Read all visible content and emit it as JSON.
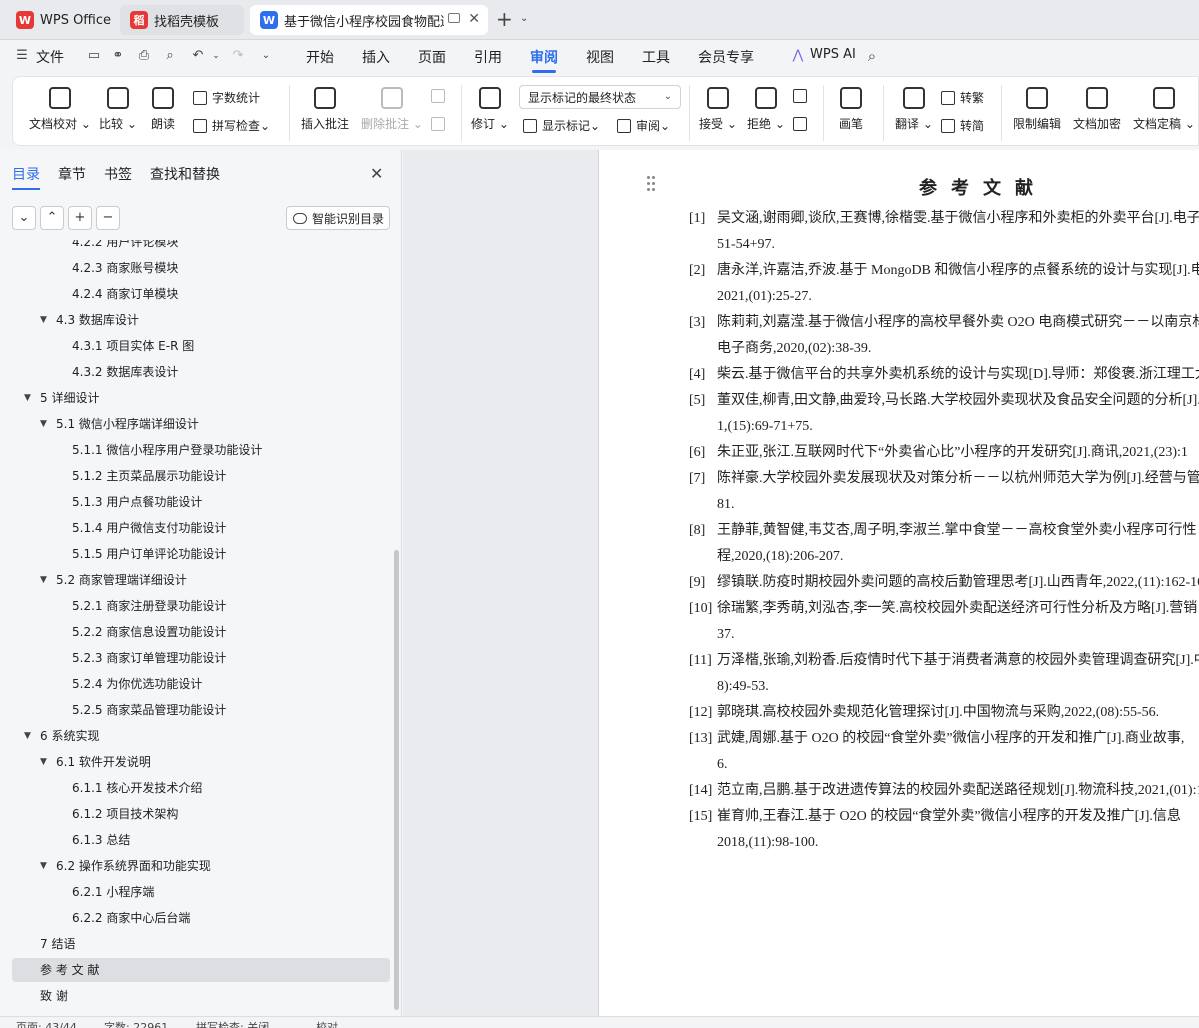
{
  "tabs": [
    {
      "label": "WPS Office",
      "logo": "W",
      "color": "#e53935"
    },
    {
      "label": "找稻壳模板",
      "logo": "稻",
      "color": "#e53935"
    },
    {
      "label": "基于微信小程序校园食物配送系",
      "logo": "W",
      "color": "#2f6fed"
    }
  ],
  "new_tab": "+",
  "menu": {
    "file": "文件",
    "items": [
      "开始",
      "插入",
      "页面",
      "引用",
      "审阅",
      "视图",
      "工具",
      "会员专享"
    ],
    "active": "审阅",
    "wps_ai": "WPS AI"
  },
  "ribbon": {
    "doc_check": "文档校对",
    "compare": "比较",
    "read_aloud": "朗读",
    "word_count": "字数统计",
    "spell_check": "拼写检查",
    "insert_comment": "插入批注",
    "delete_comment": "删除批注",
    "revise": "修订",
    "markup_state": "显示标记的最终状态",
    "show_markup": "显示标记",
    "review": "审阅",
    "accept": "接受",
    "reject": "拒绝",
    "pen": "画笔",
    "translate": "翻译",
    "to_traditional": "转繁",
    "to_simplified": "转简",
    "restrict_edit": "限制编辑",
    "encrypt_doc": "文档加密",
    "finalize_doc": "文档定稿"
  },
  "nav": {
    "tabs": [
      "目录",
      "章节",
      "书签",
      "查找和替换"
    ],
    "active_tab": "目录",
    "buttons": [
      "⌄",
      "⌃",
      "+",
      "−"
    ],
    "smart_toc": "智能识别目录"
  },
  "toc": [
    {
      "text": "4.2.2   用户评论模块",
      "level": 3
    },
    {
      "text": "4.2.3   商家账号模块",
      "level": 3
    },
    {
      "text": "4.2.4   商家订单模块",
      "level": 3
    },
    {
      "text": "4.3    数据库设计",
      "level": 2,
      "arrow": "▼"
    },
    {
      "text": "4.3.1   项目实体 E-R 图",
      "level": 3
    },
    {
      "text": "4.3.2   数据库表设计",
      "level": 3
    },
    {
      "text": "5    详细设计",
      "level": 1,
      "arrow": "▼"
    },
    {
      "text": "5.1    微信小程序端详细设计",
      "level": 2,
      "arrow": "▼"
    },
    {
      "text": "5.1.1  微信小程序用户登录功能设计",
      "level": 3
    },
    {
      "text": "5.1.2  主页菜品展示功能设计",
      "level": 3
    },
    {
      "text": "5.1.3  用户点餐功能设计",
      "level": 3
    },
    {
      "text": "5.1.4  用户微信支付功能设计",
      "level": 3
    },
    {
      "text": "5.1.5  用户订单评论功能设计",
      "level": 3
    },
    {
      "text": "5.2    商家管理端详细设计",
      "level": 2,
      "arrow": "▼"
    },
    {
      "text": "5.2.1  商家注册登录功能设计",
      "level": 3
    },
    {
      "text": "5.2.2  商家信息设置功能设计",
      "level": 3
    },
    {
      "text": "5.2.3  商家订单管理功能设计",
      "level": 3
    },
    {
      "text": "5.2.4  为你优选功能设计",
      "level": 3
    },
    {
      "text": "5.2.5  商家菜品管理功能设计",
      "level": 3
    },
    {
      "text": "6    系统实现",
      "level": 1,
      "arrow": "▼"
    },
    {
      "text": "6.1    软件开发说明",
      "level": 2,
      "arrow": "▼"
    },
    {
      "text": "6.1.1    核心开发技术介绍",
      "level": 3
    },
    {
      "text": "6.1.2    项目技术架构",
      "level": 3
    },
    {
      "text": "6.1.3    总结",
      "level": 3
    },
    {
      "text": "6.2    操作系统界面和功能实现",
      "level": 2,
      "arrow": "▼"
    },
    {
      "text": "6.2.1    小程序端",
      "level": 3
    },
    {
      "text": "6.2.2    商家中心后台端",
      "level": 3
    },
    {
      "text": "7    结语",
      "level": 1
    },
    {
      "text": "参  考  文  献",
      "level": 1,
      "selected": true
    },
    {
      "text": "致          谢",
      "level": 1
    }
  ],
  "document": {
    "title": "参考文献",
    "references": [
      {
        "num": "[1]",
        "text": "吴文涵,谢雨卿,谈欣,王赛博,徐楷雯.基于微信小程序和外卖柜的外卖平台[J].电子",
        "cont": "51-54+97."
      },
      {
        "num": "[2]",
        "text": "唐永洋,许嘉洁,乔波.基于 MongoDB 和微信小程序的点餐系统的设计与实现[J].电",
        "cont": "2021,(01):25-27."
      },
      {
        "num": "[3]",
        "text": "陈莉莉,刘嘉滢.基于微信小程序的高校早餐外卖 O2O 电商模式研究－－以南京林",
        "cont": "电子商务,2020,(02):38-39."
      },
      {
        "num": "[4]",
        "text": "柴云.基于微信平台的共享外卖机系统的设计与实现[D].导师：郑俊褒.浙江理工大",
        "cont": ""
      },
      {
        "num": "[5]",
        "text": "董双佳,柳青,田文静,曲爱玲,马长路.大学校园外卖现状及食品安全问题的分析[J].",
        "cont": "1,(15):69-71+75."
      },
      {
        "num": "[6]",
        "text": "朱正亚,张江.互联网时代下“外卖省心比”小程序的开发研究[J].商讯,2021,(23):1",
        "cont": ""
      },
      {
        "num": "[7]",
        "text": "陈祥豪.大学校园外卖发展现状及对策分析－－以杭州师范大学为例[J].经营与管",
        "cont": "81."
      },
      {
        "num": "[8]",
        "text": "王静菲,黄智健,韦艾杏,周子明,李淑兰.掌中食堂－－高校食堂外卖小程序可行性",
        "cont": "程,2020,(18):206-207."
      },
      {
        "num": "[9]",
        "text": "缪镇联.防疫时期校园外卖问题的高校后勤管理思考[J].山西青年,2022,(11):162-16",
        "cont": ""
      },
      {
        "num": "[10]",
        "text": "徐瑞繁,李秀萌,刘泓杏,李一笑.高校校园外卖配送经济可行性分析及方略[J].营销",
        "cont": "37."
      },
      {
        "num": "[11]",
        "text": "万泽楷,张瑜,刘粉香.后疫情时代下基于消费者满意的校园外卖管理调查研究[J].中",
        "cont": "8):49-53."
      },
      {
        "num": "[12]",
        "text": "郭晓琪.高校校园外卖规范化管理探讨[J].中国物流与采购,2022,(08):55-56.",
        "cont": ""
      },
      {
        "num": "[13]",
        "text": "武婕,周娜.基于 O2O 的校园“食堂外卖”微信小程序的开发和推广[J].商业故事,",
        "cont": "6."
      },
      {
        "num": "[14]",
        "text": "范立南,吕鹏.基于改进遗传算法的校园外卖配送路径规划[J].物流科技,2021,(01):1",
        "cont": ""
      },
      {
        "num": "[15]",
        "text": "崔育帅,王春江.基于 O2O 的校园“食堂外卖”微信小程序的开发及推广[J].信息",
        "cont": "2018,(11):98-100."
      }
    ]
  },
  "status": {
    "page": "页面: 43/44",
    "words": "字数: 22961",
    "spell": "拼写检查: 关闭",
    "proof": "校对"
  }
}
